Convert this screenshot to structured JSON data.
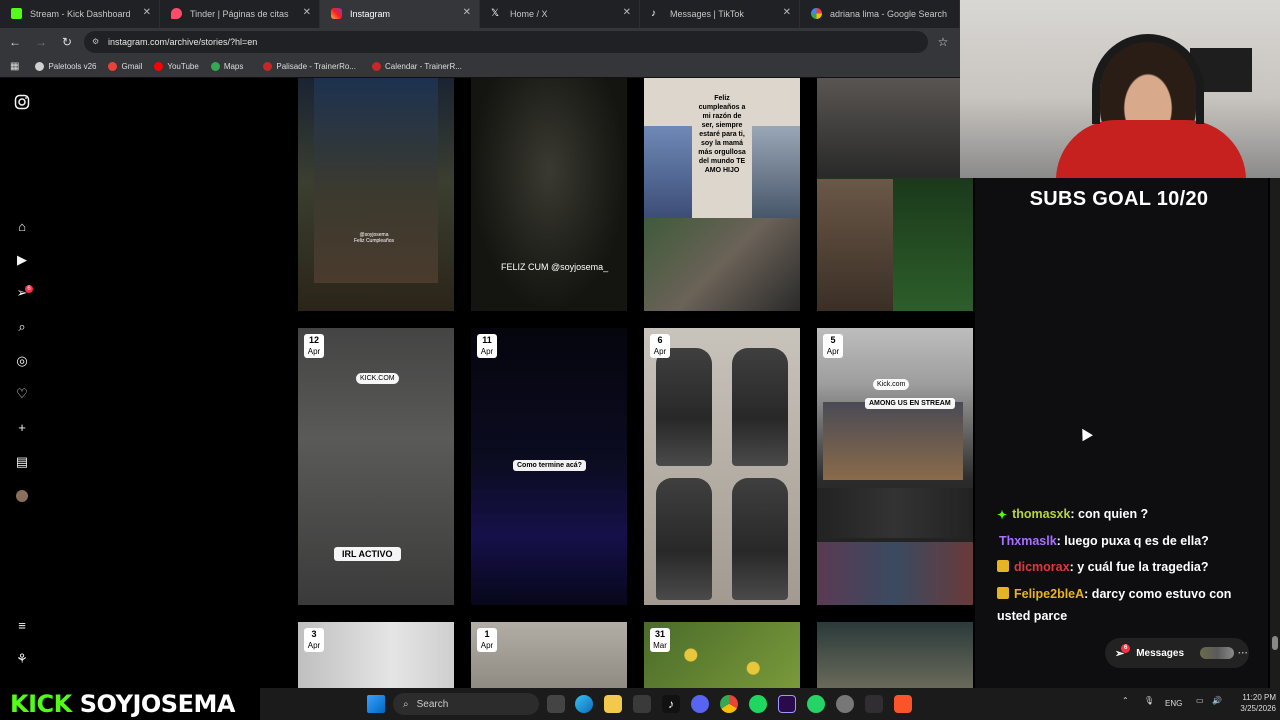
{
  "browser": {
    "tabs": [
      {
        "title": "Stream - Kick Dashboard",
        "icon": "kick-icon",
        "active": false
      },
      {
        "title": "Tinder | Páginas de citas",
        "icon": "tinder-icon",
        "active": false
      },
      {
        "title": "Instagram",
        "icon": "instagram-icon",
        "active": true
      },
      {
        "title": "Home / X",
        "icon": "x-icon",
        "active": false
      },
      {
        "title": "Messages | TikTok",
        "icon": "tiktok-icon",
        "active": false
      },
      {
        "title": "adriana lima - Google Search",
        "icon": "google-icon",
        "active": false
      }
    ],
    "url": "instagram.com/archive/stories/?hl=en",
    "bookmarks": [
      {
        "label": "Paletools v26",
        "color": "#d0d0d0"
      },
      {
        "label": "Gmail",
        "color": "#ea4335"
      },
      {
        "label": "YouTube",
        "color": "#ff0000"
      },
      {
        "label": "Maps",
        "color": "#34a853"
      },
      {
        "label": "Palisade - TrainerRo...",
        "color": "#c62828"
      },
      {
        "label": "Calendar - TrainerR...",
        "color": "#c62828"
      }
    ]
  },
  "instagram": {
    "sidebar_icons": [
      "instagram-logo-icon",
      "home-icon",
      "reels-icon",
      "messages-icon",
      "search-icon",
      "explore-icon",
      "notifications-icon",
      "create-icon",
      "dashboard-icon",
      "profile-avatar-icon",
      "menu-icon",
      "threads-icon"
    ],
    "messages_badge": "6",
    "story_rows": [
      [
        {
          "caption": "@soyjosema\nFeliz Cumpleaños",
          "date_day": "",
          "date_month": ""
        },
        {
          "caption": "FELIZ CUM @soyjosema_",
          "date_day": "",
          "date_month": ""
        },
        {
          "caption": "Feliz cumpleaños a mi razón de ser, siempre estaré para ti, soy la mamá más orgullosa del mundo TE AMO HIJO",
          "date_day": "",
          "date_month": ""
        },
        {
          "caption": "",
          "date_day": "",
          "date_month": ""
        }
      ],
      [
        {
          "caption": "IRL ACTIVO",
          "sub_caption": "KICK.COM",
          "date_day": "12",
          "date_month": "Apr"
        },
        {
          "caption": "Como termine acá?",
          "date_day": "11",
          "date_month": "Apr"
        },
        {
          "caption": "",
          "date_day": "6",
          "date_month": "Apr"
        },
        {
          "caption": "AMONG US EN STREAM",
          "sub_caption": "Kick.com",
          "date_day": "5",
          "date_month": "Apr"
        }
      ],
      [
        {
          "date_day": "3",
          "date_month": "Apr"
        },
        {
          "date_day": "1",
          "date_month": "Apr"
        },
        {
          "date_day": "31",
          "date_month": "Mar"
        },
        {
          "date_day": "",
          "date_month": ""
        }
      ]
    ],
    "messages_label": "Messages",
    "messages_pill_badge": "6"
  },
  "stream": {
    "subs_goal": "SUBS GOAL 10/20",
    "chat": [
      {
        "user": "thomasxk",
        "user_color": "#b8d43a",
        "badge": "sparkle",
        "message": ": con quien ?"
      },
      {
        "user": "Thxmaslk",
        "user_color": "#a970ff",
        "badge": "",
        "message": ": luego puxa q es de ella?"
      },
      {
        "user": "dicmorax",
        "user_color": "#e0383e",
        "badge": "crown",
        "message": ": y cuál fue la tragedia?"
      },
      {
        "user": "Felipe2bleA",
        "user_color": "#e6b422",
        "badge": "crown",
        "message": ": darcy como estuvo con usted parce"
      }
    ],
    "kick_logo": "KICK",
    "channel_name": "SOYJOSEMA",
    "accent": "#53fc18"
  },
  "taskbar": {
    "search_placeholder": "Search",
    "language": "ENG",
    "time": "11:20 PM",
    "date": "3/25/2026"
  }
}
